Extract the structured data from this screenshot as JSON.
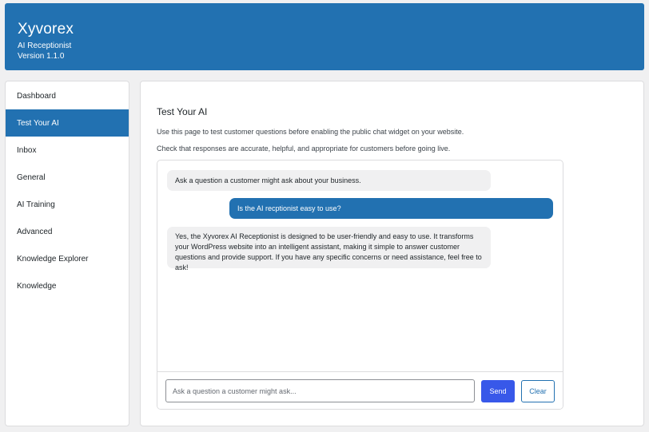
{
  "header": {
    "brand": "Xyvorex",
    "tagline": "AI Receptionist",
    "version": "Version 1.1.0"
  },
  "sidebar": {
    "items": [
      {
        "label": "Dashboard",
        "active": false
      },
      {
        "label": "Test Your AI",
        "active": true
      },
      {
        "label": "Inbox",
        "active": false
      },
      {
        "label": "General",
        "active": false
      },
      {
        "label": "AI Training",
        "active": false
      },
      {
        "label": "Advanced",
        "active": false
      },
      {
        "label": "Knowledge Explorer",
        "active": false
      },
      {
        "label": "Knowledge",
        "active": false
      }
    ]
  },
  "main": {
    "title": "Test Your AI",
    "description_1": "Use this page to test customer questions before enabling the public chat widget on your website.",
    "description_2": "Check that responses are accurate, helpful, and appropriate for customers before going live."
  },
  "chat": {
    "messages": [
      {
        "role": "bot",
        "text": "Ask a question a customer might ask about your business."
      },
      {
        "role": "user",
        "text": "Is the AI recptionist easy to use?"
      },
      {
        "role": "bot",
        "text": "Yes, the Xyvorex AI Receptionist is designed to be user-friendly and easy to use. It transforms your WordPress website into an intelligent assistant, making it simple to answer customer questions and provide support. If you have any specific concerns or need assistance, feel free to ask!"
      }
    ],
    "input_value": "",
    "input_placeholder": "Ask a question a customer might ask...",
    "send_label": "Send",
    "clear_label": "Clear"
  },
  "colors": {
    "accent": "#2271b1",
    "send_button": "#3858e9",
    "bot_bubble": "#f0f0f1",
    "page_background": "#f0f0f1"
  }
}
